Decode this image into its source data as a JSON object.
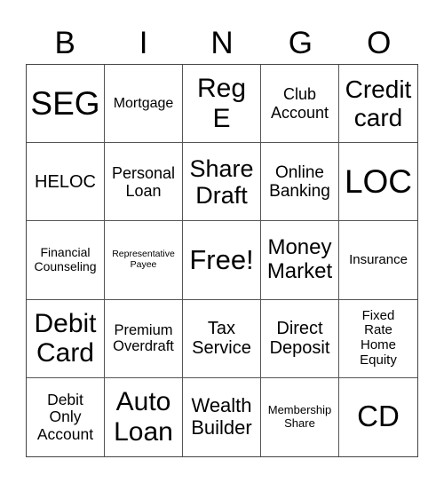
{
  "title_letters": [
    "B",
    "I",
    "N",
    "G",
    "O"
  ],
  "board": {
    "rows": [
      [
        {
          "text": "SEG",
          "size": "xl"
        },
        {
          "text": "Mortgage",
          "size": "s"
        },
        {
          "text": "Reg\nE",
          "size": "l"
        },
        {
          "text": "Club\nAccount",
          "size": "m"
        },
        {
          "text": "Credit\ncard",
          "size": "l"
        }
      ],
      [
        {
          "text": "HELOC",
          "size": "m"
        },
        {
          "text": "Personal\nLoan",
          "size": "m"
        },
        {
          "text": "Share\nDraft",
          "size": "l"
        },
        {
          "text": "Online\nBanking",
          "size": "m"
        },
        {
          "text": "LOC",
          "size": "xl"
        }
      ],
      [
        {
          "text": "Financial\nCounseling",
          "size": "s"
        },
        {
          "text": "Representative\nPayee",
          "size": "xs"
        },
        {
          "text": "Free!",
          "size": "l"
        },
        {
          "text": "Money\nMarket",
          "size": "l"
        },
        {
          "text": "Insurance",
          "size": "s"
        }
      ],
      [
        {
          "text": "Debit\nCard",
          "size": "l"
        },
        {
          "text": "Premium\nOverdraft",
          "size": "s"
        },
        {
          "text": "Tax\nService",
          "size": "m"
        },
        {
          "text": "Direct\nDeposit",
          "size": "m"
        },
        {
          "text": "Fixed\nRate\nHome\nEquity",
          "size": "s"
        }
      ],
      [
        {
          "text": "Debit\nOnly\nAccount",
          "size": "m"
        },
        {
          "text": "Auto\nLoan",
          "size": "l"
        },
        {
          "text": "Wealth\nBuilder",
          "size": "m"
        },
        {
          "text": "Membership\nShare",
          "size": "s"
        },
        {
          "text": "CD",
          "size": "xl"
        }
      ]
    ]
  }
}
